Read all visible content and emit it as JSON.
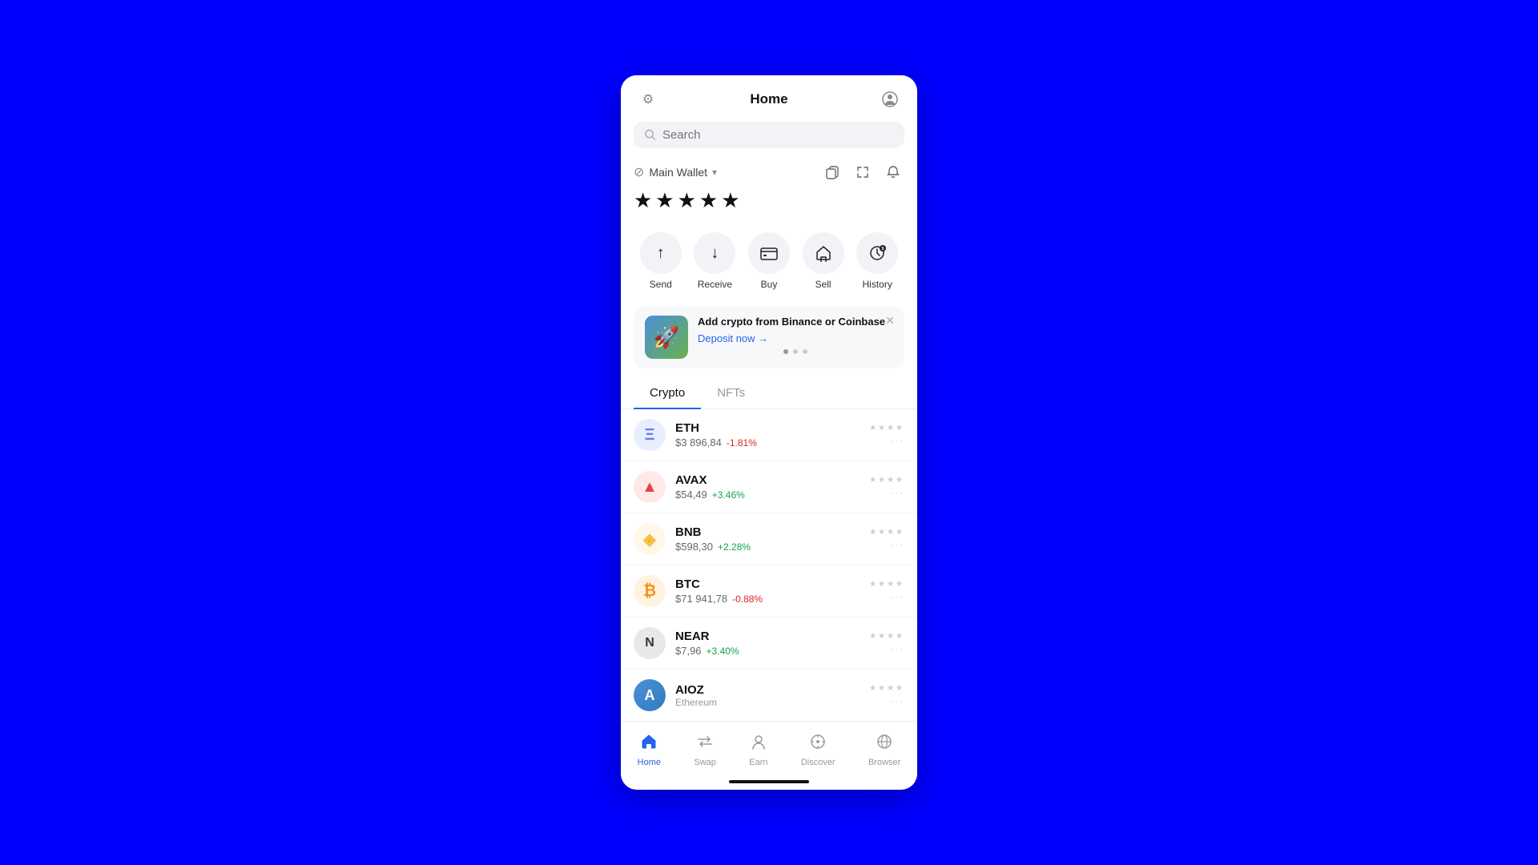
{
  "header": {
    "title": "Home",
    "settings_icon": "⚙",
    "profile_icon": "◉"
  },
  "search": {
    "placeholder": "Search"
  },
  "wallet": {
    "name": "Main Wallet",
    "balance_masked": "★★★★★",
    "icons": [
      "copy",
      "expand",
      "bell"
    ]
  },
  "actions": [
    {
      "id": "send",
      "label": "Send",
      "icon": "↑"
    },
    {
      "id": "receive",
      "label": "Receive",
      "icon": "↓"
    },
    {
      "id": "buy",
      "label": "Buy",
      "icon": "≡"
    },
    {
      "id": "sell",
      "label": "Sell",
      "icon": "🏛"
    },
    {
      "id": "history",
      "label": "History",
      "icon": "🕐"
    }
  ],
  "banner": {
    "title": "Add crypto from Binance or Coinbase",
    "link": "Deposit now →",
    "dots": [
      "active",
      "inactive",
      "inactive"
    ]
  },
  "tabs": [
    {
      "id": "crypto",
      "label": "Crypto",
      "active": true
    },
    {
      "id": "nfts",
      "label": "NFTs",
      "active": false
    }
  ],
  "crypto_list": [
    {
      "id": "eth",
      "symbol": "ETH",
      "price": "$3 896,84",
      "change": "-1.81%",
      "positive": false,
      "color": "#627eea",
      "bg": "#e8edff",
      "icon": "Ξ"
    },
    {
      "id": "avax",
      "symbol": "AVAX",
      "price": "$54,49",
      "change": "+3.46%",
      "positive": true,
      "color": "#e84142",
      "bg": "#ffe8e8",
      "icon": "▲"
    },
    {
      "id": "bnb",
      "symbol": "BNB",
      "price": "$598,30",
      "change": "+2.28%",
      "positive": true,
      "color": "#f3ba2f",
      "bg": "#fff8e8",
      "icon": "◈"
    },
    {
      "id": "btc",
      "symbol": "BTC",
      "price": "$71 941,78",
      "change": "-0.88%",
      "positive": false,
      "color": "#f7931a",
      "bg": "#fff3e0",
      "icon": "₿"
    },
    {
      "id": "near",
      "symbol": "NEAR",
      "price": "$7,96",
      "change": "+3.40%",
      "positive": true,
      "color": "#333",
      "bg": "#e8e8e8",
      "icon": "N"
    }
  ],
  "aioz": {
    "symbol": "AIOZ",
    "subtitle": "Ethereum"
  },
  "bottom_nav": [
    {
      "id": "home",
      "label": "Home",
      "icon": "⌂",
      "active": true
    },
    {
      "id": "swap",
      "label": "Swap",
      "icon": "⇄",
      "active": false
    },
    {
      "id": "earn",
      "label": "Earn",
      "icon": "👤",
      "active": false
    },
    {
      "id": "discover",
      "label": "Discover",
      "icon": "💡",
      "active": false
    },
    {
      "id": "browser",
      "label": "Browser",
      "icon": "◎",
      "active": false
    }
  ]
}
